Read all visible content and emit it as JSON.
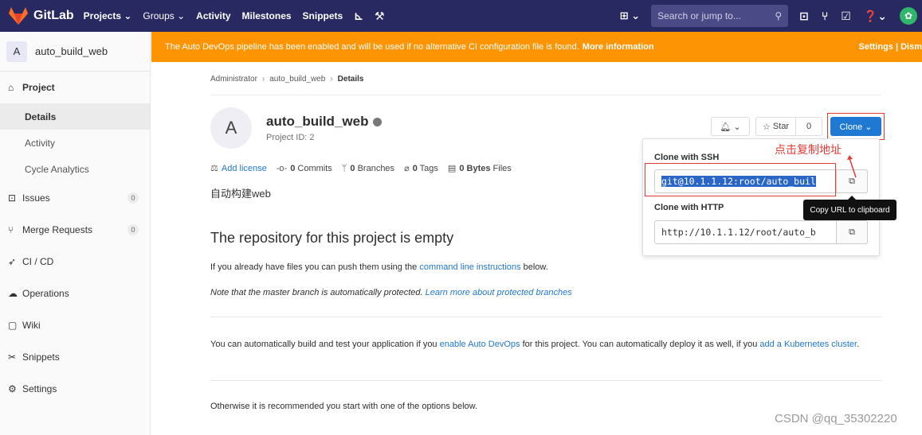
{
  "navbar": {
    "brand": "GitLab",
    "projects": "Projects ⌄",
    "groups": "Groups ⌄",
    "activity": "Activity",
    "milestones": "Milestones",
    "snippets": "Snippets",
    "search_placeholder": "Search or jump to..."
  },
  "sidebar": {
    "avatar_letter": "A",
    "project_name": "auto_build_web",
    "project_section": "Project",
    "sub_details": "Details",
    "sub_activity": "Activity",
    "sub_cycle": "Cycle Analytics",
    "issues": "Issues",
    "issues_count": "0",
    "merge_requests": "Merge Requests",
    "mr_count": "0",
    "cicd": "CI / CD",
    "operations": "Operations",
    "wiki": "Wiki",
    "snippets": "Snippets",
    "settings": "Settings"
  },
  "banner": {
    "text": "The Auto DevOps pipeline has been enabled and will be used if no alternative CI configuration file is found.",
    "more": "More information",
    "right": "Settings | Dism"
  },
  "breadcrumb": {
    "admin": "Administrator",
    "project": "auto_build_web",
    "current": "Details"
  },
  "project": {
    "avatar_letter": "A",
    "title": "auto_build_web",
    "id_text": "Project ID: 2",
    "add_license": "Add license",
    "commits_count": "0",
    "commits_label": "Commits",
    "branches_count": "0",
    "branches_label": "Branches",
    "tags_count": "0",
    "tags_label": "Tags",
    "files_size": "0 Bytes",
    "files_label": "Files",
    "description": "自动构建web"
  },
  "actions": {
    "star_label": "Star",
    "star_count": "0",
    "clone_label": "Clone ⌄"
  },
  "clone": {
    "ssh_label": "Clone with SSH",
    "ssh_url": "git@10.1.1.12:root/auto_buil",
    "http_label": "Clone with HTTP",
    "http_url": "http://10.1.1.12/root/auto_b",
    "tooltip": "Copy URL to clipboard"
  },
  "annotation": "点击复制地址",
  "empty": {
    "title": "The repository for this project is empty",
    "p1_pre": "If you already have files you can push them using the",
    "p1_link": "command line instructions",
    "p1_post": "below.",
    "p2_pre": "Note that the master branch is automatically protected.",
    "p2_link": "Learn more about protected branches",
    "p3_pre": "You can automatically build and test your application if you",
    "p3_link1": "enable Auto DevOps",
    "p3_mid": "for this project. You can automatically deploy it as well, if you",
    "p3_link2": "add a Kubernetes cluster",
    "p3_post": ".",
    "p4": "Otherwise it is recommended you start with one of the options below."
  },
  "watermark": "CSDN @qq_35302220"
}
